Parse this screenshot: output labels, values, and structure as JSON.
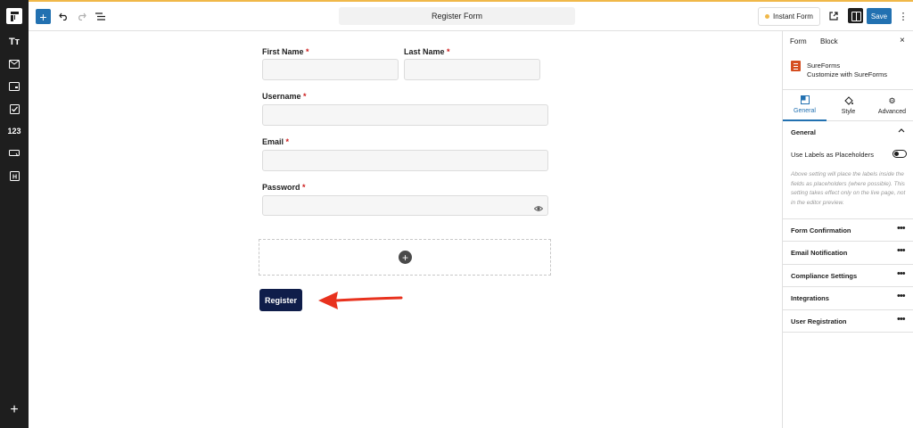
{
  "toolbar": {
    "add_label": "+",
    "undo_icon": "undo-icon",
    "redo_icon": "redo-icon",
    "list_icon": "list-view-icon",
    "form_title": "Register Form",
    "instant_form_label": "Instant Form",
    "save_label": "Save",
    "more_label": "⋮"
  },
  "sidebar": {
    "items": [
      {
        "icon": "text-icon",
        "glyph": "Tт"
      },
      {
        "icon": "email-icon",
        "glyph": ""
      },
      {
        "icon": "input-icon",
        "glyph": ""
      },
      {
        "icon": "checkbox-icon",
        "glyph": ""
      },
      {
        "icon": "number-icon",
        "glyph": "123"
      },
      {
        "icon": "button-icon",
        "glyph": ""
      },
      {
        "icon": "heading-icon",
        "glyph": "H"
      }
    ],
    "add_label": "+"
  },
  "form": {
    "first_name": {
      "label": "First Name",
      "required": "*"
    },
    "last_name": {
      "label": "Last Name",
      "required": "*"
    },
    "username": {
      "label": "Username",
      "required": "*"
    },
    "email": {
      "label": "Email",
      "required": "*"
    },
    "password": {
      "label": "Password",
      "required": "*"
    },
    "add_block_label": "+",
    "submit_label": "Register"
  },
  "panel": {
    "tabs": [
      "Form",
      "Block"
    ],
    "close_label": "×",
    "plugin_name": "SureForms",
    "plugin_desc": "Customize with SureForms",
    "sub_tabs": [
      {
        "label": "General",
        "icon": "general-icon"
      },
      {
        "label": "Style",
        "icon": "paint-bucket-icon"
      },
      {
        "label": "Advanced",
        "icon": "gear-icon"
      }
    ],
    "general_title": "General",
    "toggle_label": "Use Labels as Placeholders",
    "help_text": "Above setting will place the labels inside the fields as placeholders (where possible). This setting takes effect only on the live page, not in the editor preview.",
    "sections": [
      "Form Confirmation",
      "Email Notification",
      "Compliance Settings",
      "Integrations",
      "User Registration"
    ]
  },
  "colors": {
    "accent": "#2271b1",
    "submit_button": "#0f1d4a",
    "required": "#cc1818",
    "annotation_arrow": "#e8321e"
  }
}
